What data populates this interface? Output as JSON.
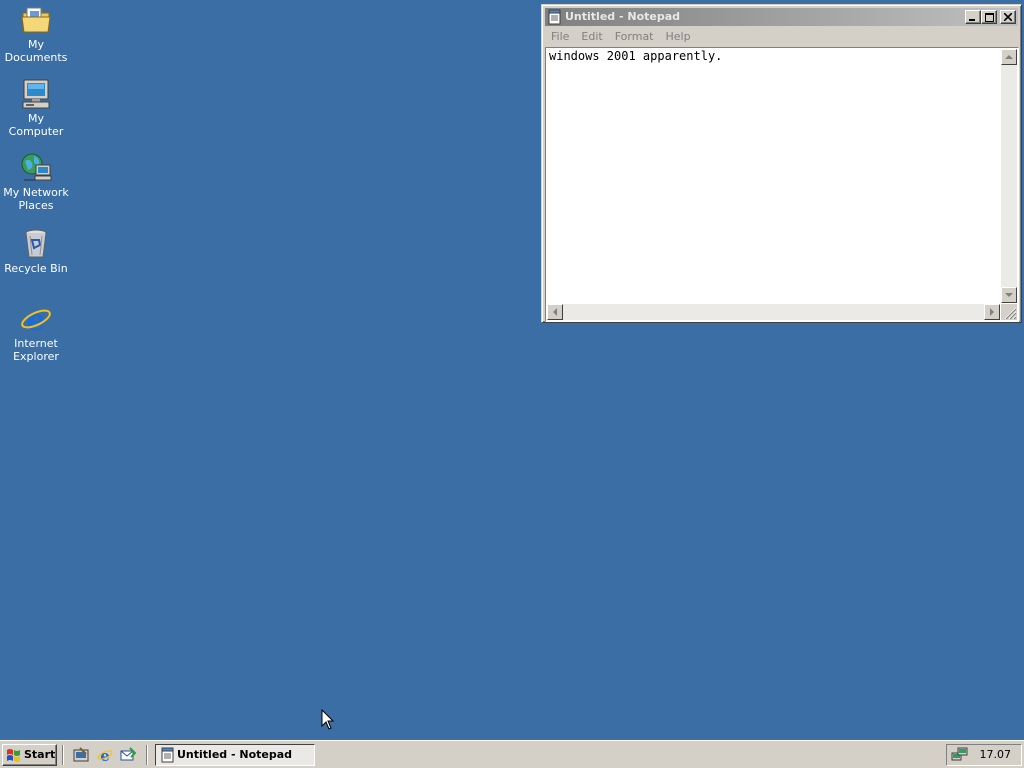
{
  "desktop": {
    "background_color": "#3a6ea5",
    "icons": [
      {
        "label": "My Documents",
        "icon": "my-documents-folder-icon"
      },
      {
        "label": "My Computer",
        "icon": "my-computer-icon"
      },
      {
        "label": "My Network Places",
        "icon": "network-places-icon"
      },
      {
        "label": "Recycle Bin",
        "icon": "recycle-bin-icon"
      },
      {
        "label": "Internet Explorer",
        "icon": "internet-explorer-icon"
      }
    ]
  },
  "notepad": {
    "title": "Untitled - Notepad",
    "active": false,
    "menu": [
      "File",
      "Edit",
      "Format",
      "Help"
    ],
    "content": "windows 2001 apparently.",
    "caption_buttons": [
      "minimize",
      "maximize",
      "close"
    ]
  },
  "taskbar": {
    "start_label": "Start",
    "quick_launch": [
      "show-desktop-icon",
      "internet-explorer-icon",
      "outlook-express-icon"
    ],
    "tasks": [
      {
        "label": "Untitled - Notepad",
        "icon": "notepad-icon"
      }
    ],
    "tray": {
      "clock": "17.07",
      "icons": [
        "network-icon"
      ]
    }
  }
}
